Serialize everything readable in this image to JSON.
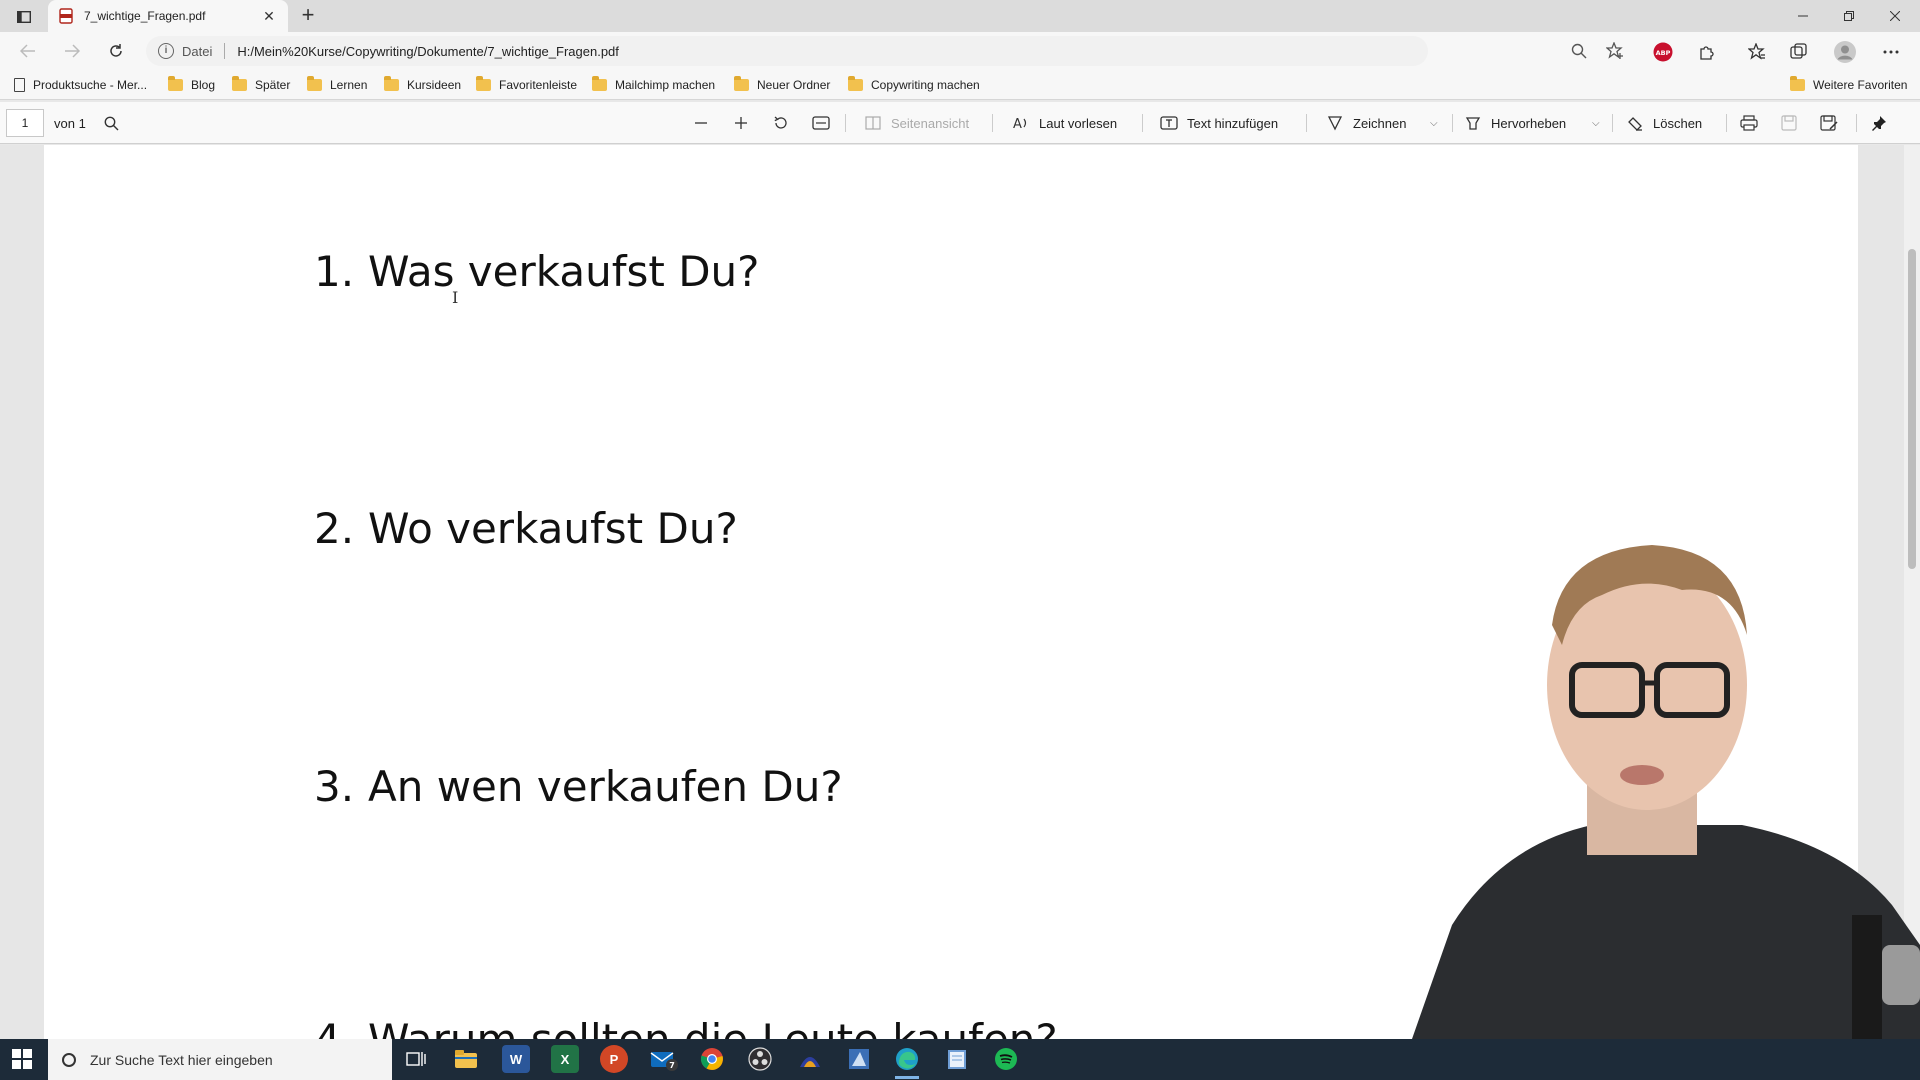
{
  "browser": {
    "tab_title": "7_wichtige_Fragen.pdf",
    "tab_close": "✕",
    "new_tab": "+",
    "address": {
      "scheme_label": "Datei",
      "url": "H:/Mein%20Kurse/Copywriting/Dokumente/7_wichtige_Fragen.pdf"
    },
    "extension_badge": "ABP",
    "bookmarks": [
      {
        "label": "Produktsuche - Mer...",
        "icon": "page-icon"
      },
      {
        "label": "Blog",
        "icon": "folder-icon"
      },
      {
        "label": "Später",
        "icon": "folder-icon"
      },
      {
        "label": "Lernen",
        "icon": "folder-icon"
      },
      {
        "label": "Kursideen",
        "icon": "folder-icon"
      },
      {
        "label": "Favoritenleiste",
        "icon": "folder-icon"
      },
      {
        "label": "Mailchimp machen",
        "icon": "folder-icon"
      },
      {
        "label": "Neuer Ordner",
        "icon": "folder-icon"
      },
      {
        "label": "Copywriting machen",
        "icon": "folder-icon"
      }
    ],
    "more_favorites": "Weitere Favoriten"
  },
  "pdf_toolbar": {
    "page_number": "1",
    "page_of": "von 1",
    "page_view": "Seitenansicht",
    "read_aloud": "Laut vorlesen",
    "add_text": "Text hinzufügen",
    "draw": "Zeichnen",
    "highlight": "Hervorheben",
    "erase": "Löschen"
  },
  "document": {
    "questions": [
      {
        "number": "1.",
        "text": "Was verkaufst Du?"
      },
      {
        "number": "2.",
        "text": "Wo verkaufst Du?"
      },
      {
        "number": "3.",
        "text": "An wen verkaufen Du?"
      },
      {
        "number": "4.",
        "text": "Warum sollten die Leute kaufen?"
      }
    ]
  },
  "taskbar": {
    "search_placeholder": "Zur Suche Text hier eingeben",
    "apps": [
      {
        "name": "task-view-icon",
        "color": "#1d2b39"
      },
      {
        "name": "file-explorer-icon",
        "color": "#f2c14e"
      },
      {
        "name": "word-icon",
        "color": "#2b579a",
        "glyph": "W"
      },
      {
        "name": "excel-icon",
        "color": "#217346",
        "glyph": "X"
      },
      {
        "name": "powerpoint-icon",
        "color": "#d24726",
        "glyph": "P"
      },
      {
        "name": "mail-icon",
        "color": "#0f6cbd",
        "badge": "7"
      },
      {
        "name": "chrome-icon",
        "color": "#e8e8e8"
      },
      {
        "name": "obs-icon",
        "color": "#3a3a3a"
      },
      {
        "name": "app-icon",
        "color": "#5a2ea6"
      },
      {
        "name": "editor-icon",
        "color": "#3b6fb6"
      },
      {
        "name": "edge-icon",
        "color": "#1fa0c8"
      },
      {
        "name": "notepad-icon",
        "color": "#6f9ed6"
      },
      {
        "name": "spotify-icon",
        "color": "#1db954"
      }
    ]
  }
}
